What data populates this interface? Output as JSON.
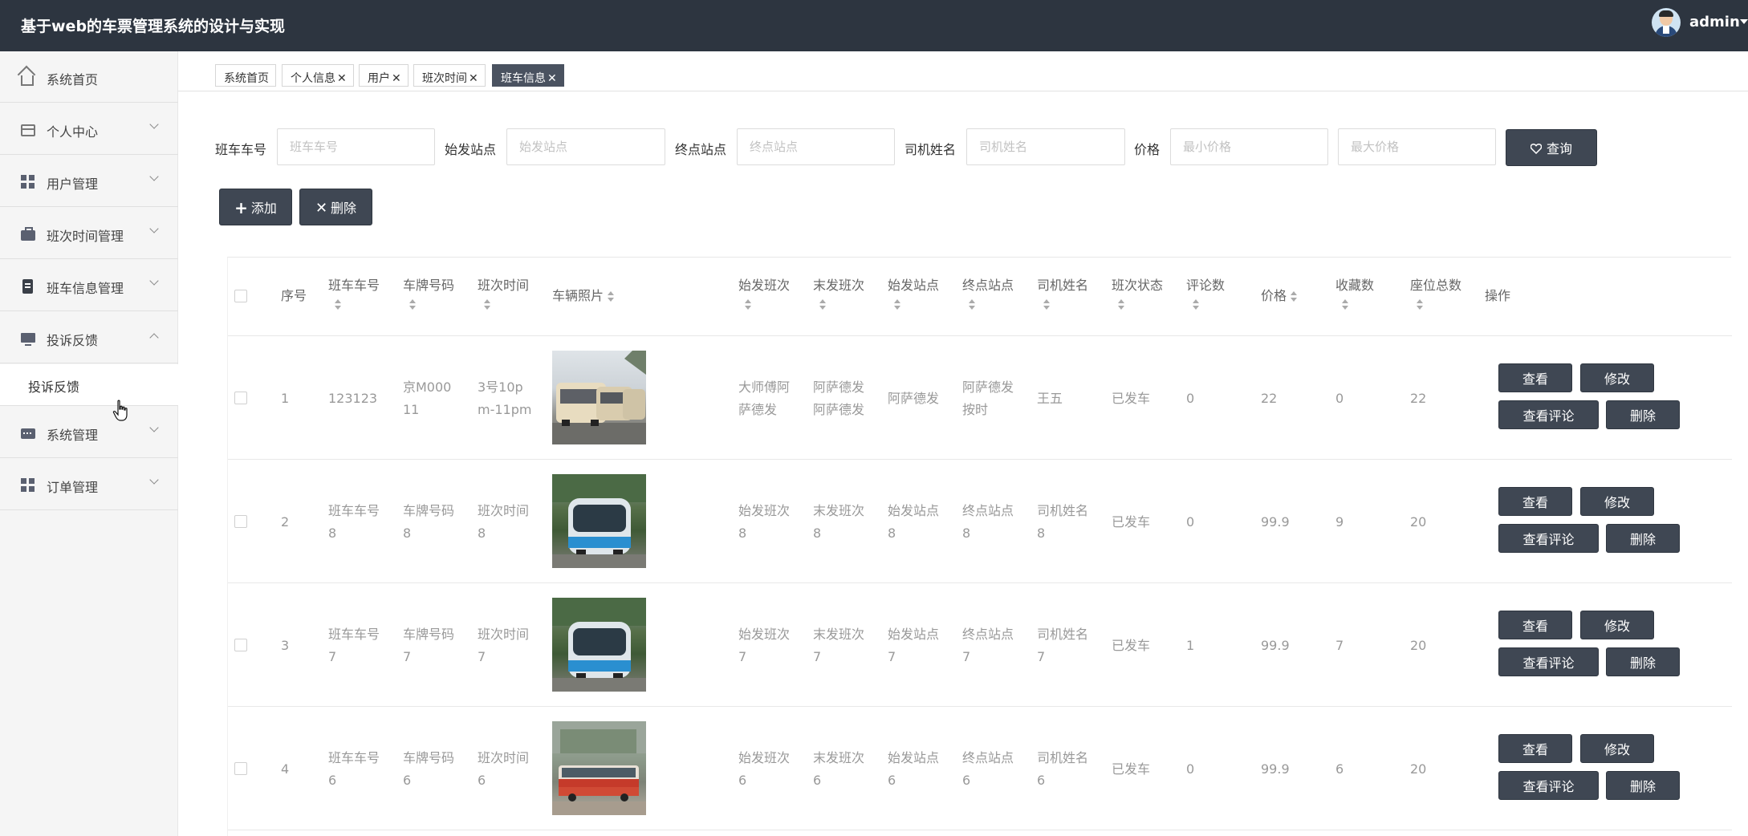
{
  "app": {
    "title": "基于web的车票管理系统的设计与实现",
    "username": "admin"
  },
  "sidebar": {
    "items": [
      {
        "label": "系统首页",
        "icon": "home-icon"
      },
      {
        "label": "个人中心",
        "icon": "id-card-icon"
      },
      {
        "label": "用户管理",
        "icon": "grid-icon"
      },
      {
        "label": "班次时间管理",
        "icon": "briefcase-icon"
      },
      {
        "label": "班车信息管理",
        "icon": "clipboard-icon"
      },
      {
        "label": "投诉反馈",
        "icon": "monitor-icon"
      },
      {
        "label": "系统管理",
        "icon": "chat-icon"
      },
      {
        "label": "订单管理",
        "icon": "grid-icon"
      }
    ],
    "sub_items": [
      {
        "label": "投诉反馈"
      }
    ]
  },
  "tabs": [
    {
      "label": "系统首页",
      "closable": false
    },
    {
      "label": "个人信息",
      "closable": true
    },
    {
      "label": "用户",
      "closable": true
    },
    {
      "label": "班次时间",
      "closable": true
    },
    {
      "label": "班车信息",
      "closable": true,
      "active": true
    }
  ],
  "search": {
    "fields": [
      {
        "label": "班车车号",
        "placeholder": "班车车号"
      },
      {
        "label": "始发站点",
        "placeholder": "始发站点"
      },
      {
        "label": "终点站点",
        "placeholder": "终点站点"
      },
      {
        "label": "司机姓名",
        "placeholder": "司机姓名"
      },
      {
        "label": "价格",
        "placeholder": "最小价格"
      },
      {
        "placeholder": "最大价格"
      }
    ],
    "query_label": "查询"
  },
  "toolbar": {
    "add_label": "添加",
    "delete_label": "删除"
  },
  "table": {
    "columns": {
      "index": "序号",
      "bus_no": "班车车号",
      "plate": "车牌号码",
      "time": "班次时间",
      "photo": "车辆照片",
      "first": "始发班次",
      "last": "末发班次",
      "start": "始发站点",
      "end": "终点站点",
      "driver": "司机姓名",
      "status": "班次状态",
      "comments": "评论数",
      "price": "价格",
      "favorites": "收藏数",
      "seats": "座位总数",
      "actions": "操作"
    },
    "rows": [
      {
        "index": "1",
        "bus_no": "123123",
        "plate": "京M000\n11",
        "time": "3号10p\nm-11pm",
        "first": "大师傅阿\n萨德发",
        "last": "阿萨德发\n阿萨德发",
        "start": "阿萨德发",
        "end": "阿萨德发\n按时",
        "driver": "王五",
        "status": "已发车",
        "comments": "0",
        "price": "22",
        "favorites": "0",
        "seats": "22"
      },
      {
        "index": "2",
        "bus_no": "班车车号\n8",
        "plate": "车牌号码\n8",
        "time": "班次时间\n8",
        "first": "始发班次\n8",
        "last": "末发班次\n8",
        "start": "始发站点\n8",
        "end": "终点站点\n8",
        "driver": "司机姓名\n8",
        "status": "已发车",
        "comments": "0",
        "price": "99.9",
        "favorites": "9",
        "seats": "20"
      },
      {
        "index": "3",
        "bus_no": "班车车号\n7",
        "plate": "车牌号码\n7",
        "time": "班次时间\n7",
        "first": "始发班次\n7",
        "last": "末发班次\n7",
        "start": "始发站点\n7",
        "end": "终点站点\n7",
        "driver": "司机姓名\n7",
        "status": "已发车",
        "comments": "1",
        "price": "99.9",
        "favorites": "7",
        "seats": "20"
      },
      {
        "index": "4",
        "bus_no": "班车车号\n6",
        "plate": "车牌号码\n6",
        "time": "班次时间\n6",
        "first": "始发班次\n6",
        "last": "末发班次\n6",
        "start": "始发站点\n6",
        "end": "终点站点\n6",
        "driver": "司机姓名\n6",
        "status": "已发车",
        "comments": "0",
        "price": "99.9",
        "favorites": "6",
        "seats": "20"
      }
    ],
    "actions": {
      "view": "查看",
      "edit": "修改",
      "view_comments": "查看评论",
      "delete": "删除"
    }
  }
}
